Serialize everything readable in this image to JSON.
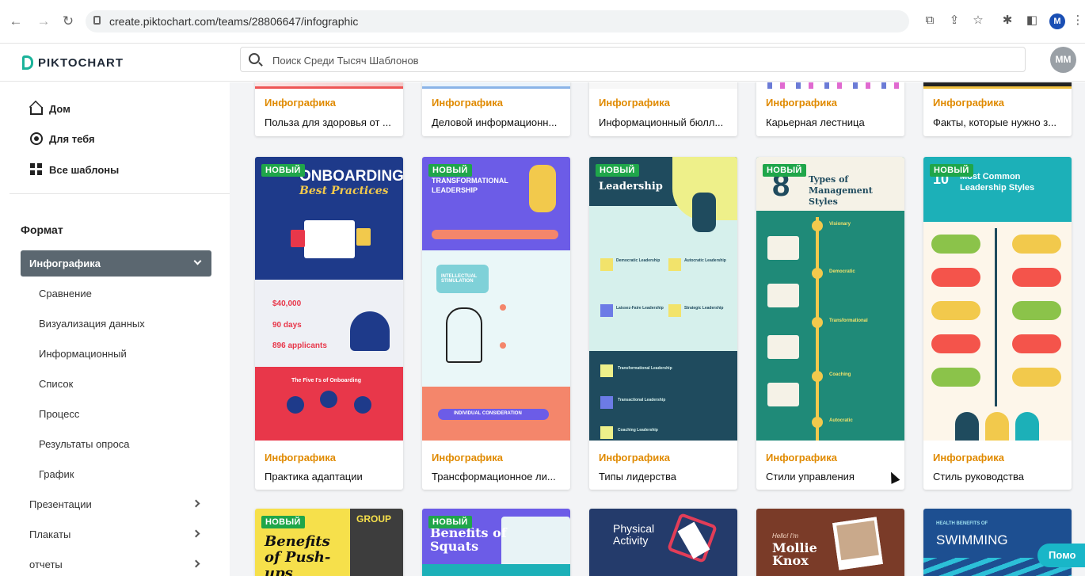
{
  "browser": {
    "url": "create.piktochart.com/teams/28806647/infographic",
    "profile_initial": "M"
  },
  "header": {
    "logo_text": "PIKTOCHART",
    "search_placeholder": "Поиск Среди Тысяч Шаблонов",
    "avatar_initials": "MM"
  },
  "sidebar": {
    "nav": [
      {
        "label": "Дом",
        "icon": "home-icon"
      },
      {
        "label": "Для тебя",
        "icon": "for-you-icon"
      },
      {
        "label": "Все шаблоны",
        "icon": "grid-icon"
      }
    ],
    "format_title": "Формат",
    "active_format": "Инфографика",
    "sub_items": [
      "Сравнение",
      "Визуализация данных",
      "Информационный",
      "Список",
      "Процесс",
      "Результаты опроса",
      "График"
    ],
    "groups": [
      "Презентации",
      "Плакаты",
      "отчеты"
    ]
  },
  "badge_label": "НОВЫЙ",
  "category_label": "Инфографика",
  "row1": [
    {
      "title": "Польза для здоровья от ..."
    },
    {
      "title": "Деловой информационн..."
    },
    {
      "title": "Информационный бюлл..."
    },
    {
      "title": "Карьерная лестница"
    },
    {
      "title": "Факты, которые нужно з..."
    }
  ],
  "row2": [
    {
      "title": "Практика адаптации",
      "thumb_title": "ONBOARDING",
      "thumb_sub": "Best Practices",
      "stats": [
        "$40,000",
        "90 days",
        "896 applicants"
      ],
      "section": "The Five I's of Onboarding"
    },
    {
      "title": "Трансформационное ли...",
      "thumb_title": "TRANSFORMATIONAL LEADERSHIP",
      "thumb_sub": "INTELLECTUAL STIMULATION",
      "section": "INDIVIDUAL CONSIDERATION"
    },
    {
      "title": "Типы лидерства",
      "thumb_title": "Leadership",
      "items": [
        "Democratic Leadership",
        "Autocratic Leadership",
        "Laissez-Faire Leadership",
        "Strategic Leadership",
        "Transformational Leadership",
        "Transactional Leadership",
        "Coaching Leadership"
      ]
    },
    {
      "title": "Стили управления",
      "thumb_num": "8",
      "thumb_title": "Types of Management Styles",
      "items": [
        "Visionary",
        "Democratic",
        "Transformational",
        "Coaching",
        "Autocratic"
      ]
    },
    {
      "title": "Стиль руководства",
      "thumb_num": "10",
      "thumb_title": "Most Common Leadership Styles"
    }
  ],
  "row3": [
    {
      "thumb_title": "Benefits of Push-ups",
      "thumb_side": "GROUP"
    },
    {
      "thumb_title": "Benefits of Squats"
    },
    {
      "thumb_title": "Physical Activity"
    },
    {
      "thumb_pre": "Hello! I'm",
      "thumb_title": "Mollie Knox"
    },
    {
      "thumb_pre": "HEALTH BENEFITS OF",
      "thumb_title": "SWIMMING"
    }
  ],
  "help_label": "Помо",
  "colors": {
    "accent": "#1fa64a",
    "category": "#e08a00",
    "sidebar_active": "#5b6770",
    "brand": "#1bb39a"
  }
}
